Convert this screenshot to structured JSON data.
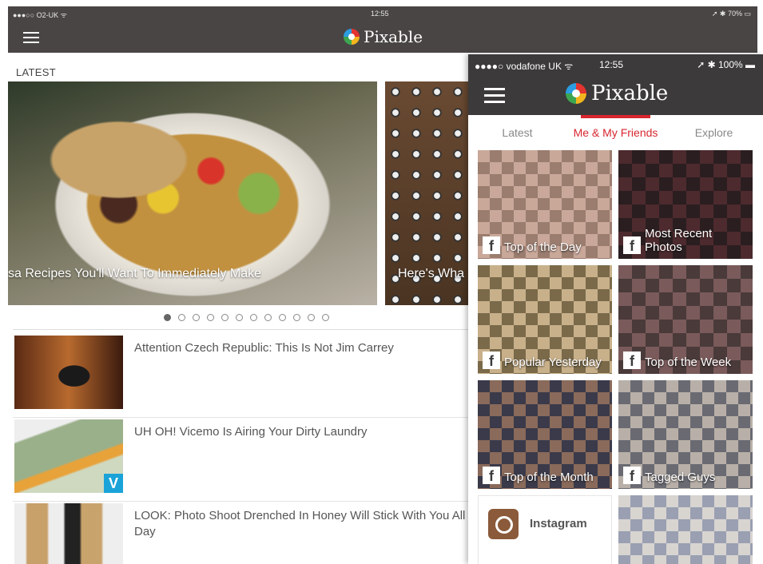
{
  "tablet": {
    "status": {
      "carrier": "●●●○○ O2-UK ᯤ",
      "time": "12:55",
      "battery": "➚ ✱ 70% ▭"
    },
    "brand": "Pixable",
    "section_label": "LATEST",
    "hero": [
      {
        "caption": "sa Recipes You'll Want To Immediately Make"
      },
      {
        "caption": "Here's Wha"
      }
    ],
    "pagination": {
      "total": 12,
      "active": 0
    },
    "articles": [
      {
        "title": "Attention Czech Republic: This Is Not Jim Carrey"
      },
      {
        "title": "UH OH! Vicemo Is Airing Your Dirty Laundry",
        "badge": "V"
      },
      {
        "title": "LOOK: Photo Shoot Drenched In Honey Will Stick With You All Day"
      }
    ]
  },
  "phone": {
    "status": {
      "carrier": "●●●●○ vodafone UK ᯤ",
      "time": "12:55",
      "battery": "➚ ✱ 100% ▬"
    },
    "brand": "Pixable",
    "tabs": [
      "Latest",
      "Me & My Friends",
      "Explore"
    ],
    "active_tab": 1,
    "accent_color": "#d8262f",
    "tiles": [
      {
        "label": "Top of the Day",
        "icon": "facebook-icon"
      },
      {
        "label": "Most Recent Photos",
        "icon": "facebook-icon"
      },
      {
        "label": "Popular Yesterday",
        "icon": "facebook-icon"
      },
      {
        "label": "Top of the Week",
        "icon": "facebook-icon"
      },
      {
        "label": "Top of the Month",
        "icon": "facebook-icon"
      },
      {
        "label": "Tagged Guys",
        "icon": "facebook-icon"
      }
    ],
    "instagram": {
      "label": "Instagram",
      "icon": "instagram-icon"
    },
    "fb_glyph": "f"
  }
}
